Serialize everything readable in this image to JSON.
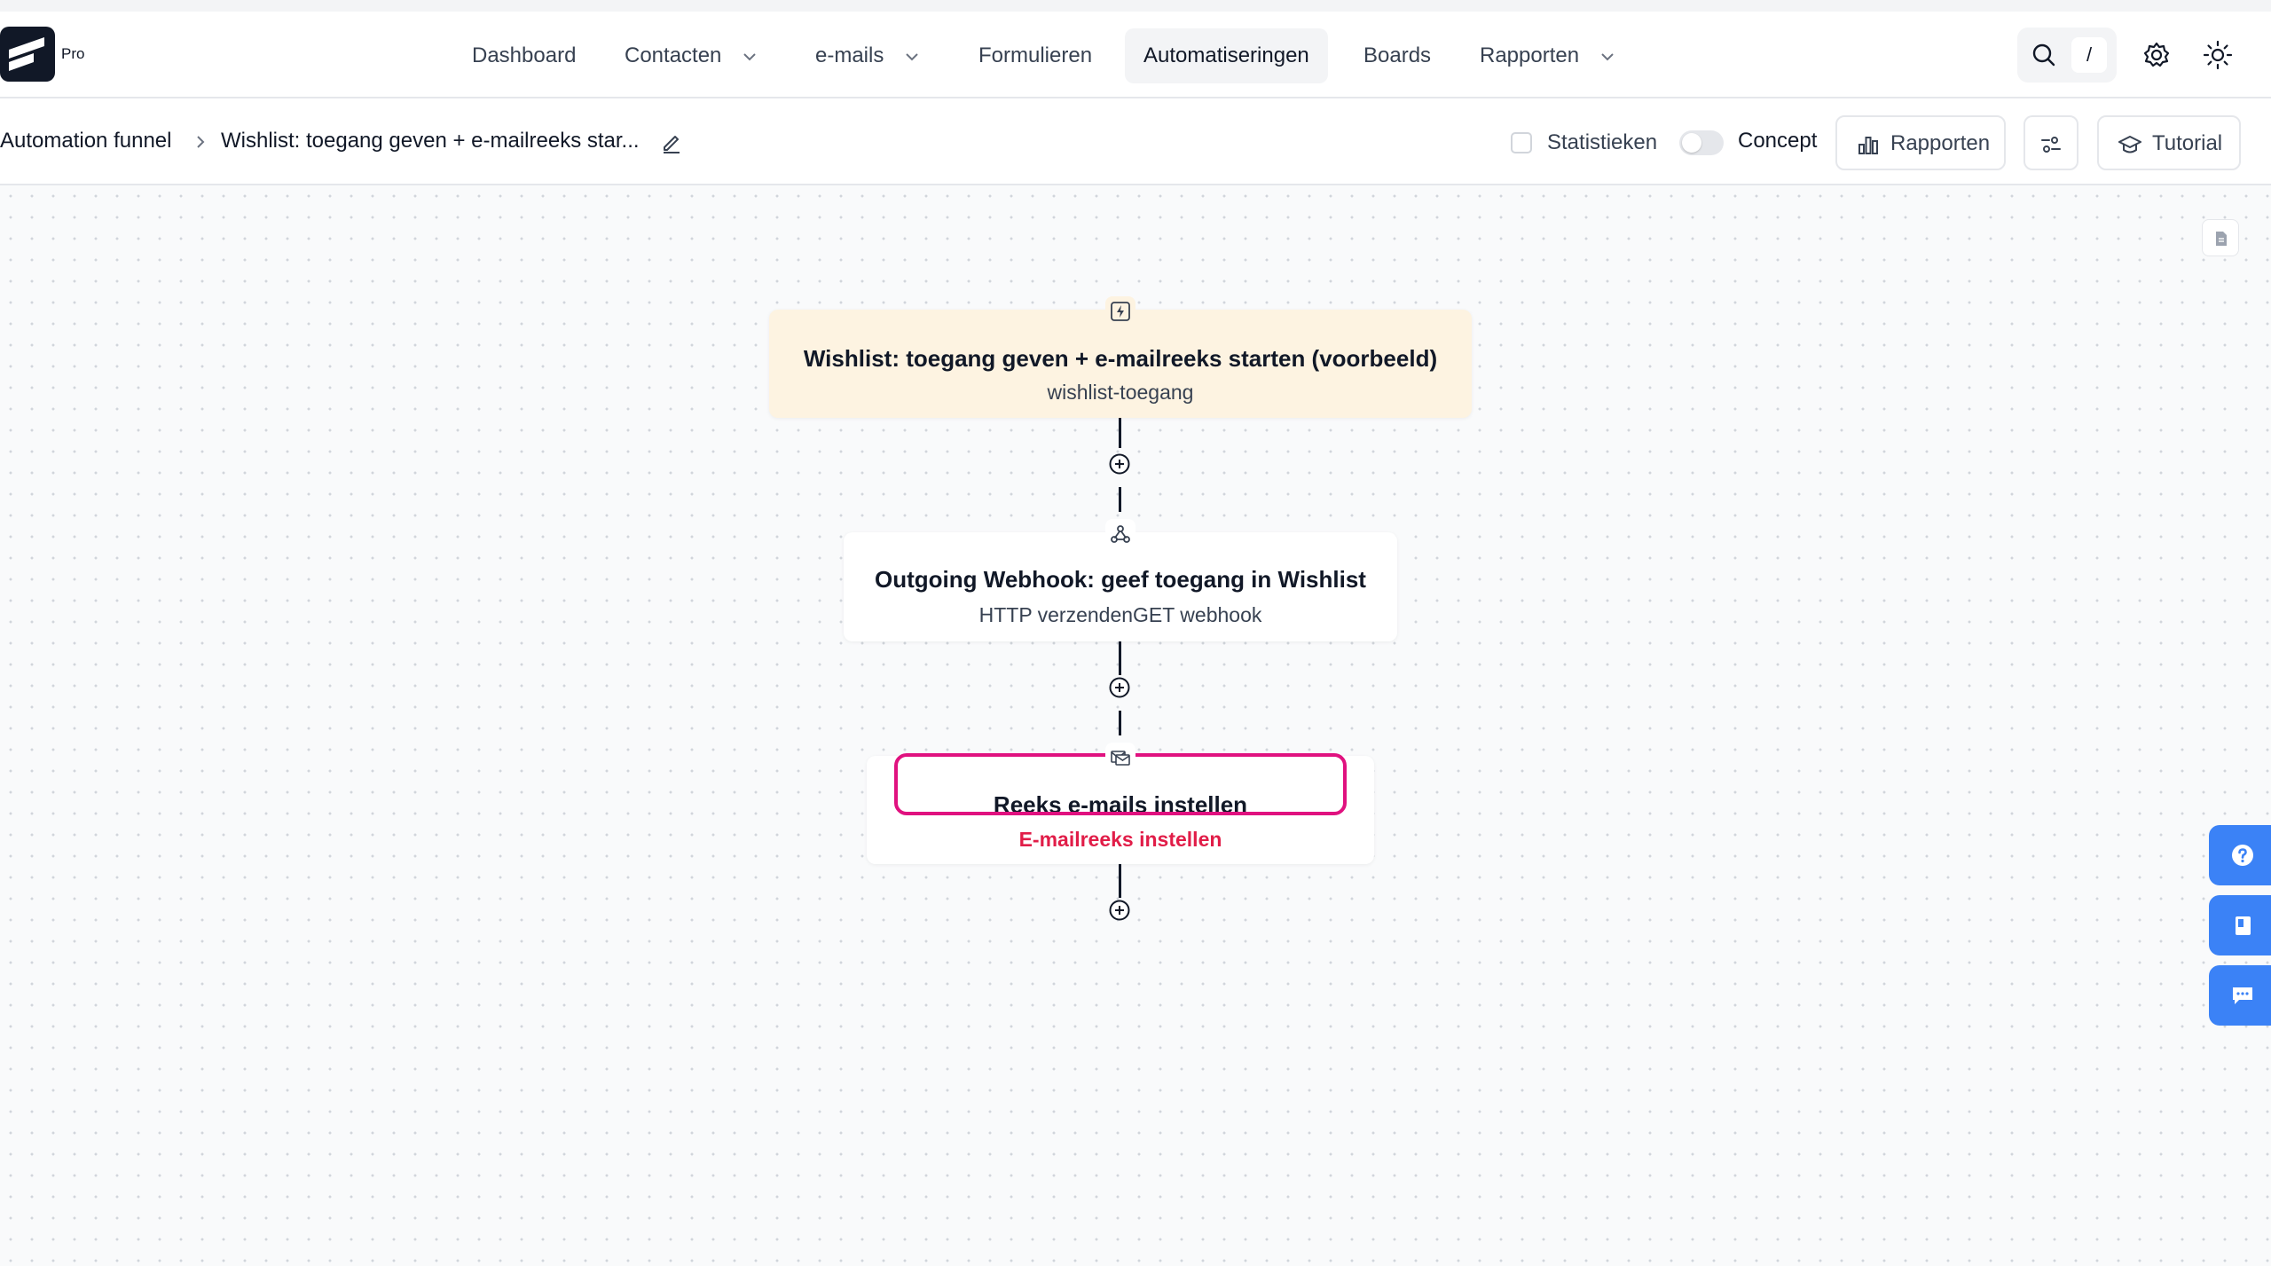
{
  "app": {
    "badge": "Pro",
    "logo_icon": "fluentcrm-logo-icon"
  },
  "nav": {
    "items": [
      {
        "label": "Dashboard",
        "has_dropdown": false
      },
      {
        "label": "Contacten",
        "has_dropdown": true
      },
      {
        "label": "e-mails",
        "has_dropdown": true
      },
      {
        "label": "Formulieren",
        "has_dropdown": false
      },
      {
        "label": "Automatiseringen",
        "has_dropdown": false,
        "active": true
      },
      {
        "label": "Boards",
        "has_dropdown": false
      },
      {
        "label": "Rapporten",
        "has_dropdown": true
      }
    ],
    "search_shortcut": "/",
    "icons": [
      "search-icon",
      "settings-icon",
      "theme-sun-icon"
    ]
  },
  "toolbar": {
    "breadcrumb_root": "Automation funnel",
    "breadcrumb_current": "Wishlist: toegang geven + e-mailreeks star...",
    "statistics_label": "Statistieken",
    "statistics_checked": false,
    "concept_label": "Concept",
    "concept_on": false,
    "reports_button": "Rapporten",
    "tutorial_button": "Tutorial"
  },
  "flow": {
    "trigger": {
      "title": "Wishlist: toegang geven + e-mailreeks starten (voorbeeld)",
      "subtitle": "wishlist-toegang",
      "icon": "lightning-icon",
      "background": "#fdf3e1"
    },
    "step1": {
      "title": "Outgoing Webhook: geef toegang in Wishlist",
      "subtitle": "HTTP verzendenGET webhook",
      "icon": "webhook-icon"
    },
    "step2": {
      "title": "Reeks e-mails instellen",
      "subtitle": "E-mailreeks instellen",
      "icon": "email-sequence-icon",
      "highlight_color": "#e0117f",
      "subtitle_color": "#e11d48"
    }
  },
  "side_buttons": [
    "help-icon",
    "docs-book-icon",
    "chat-icon"
  ],
  "colors": {
    "accent_blue": "#3b82f6",
    "text_dark": "#111827"
  }
}
